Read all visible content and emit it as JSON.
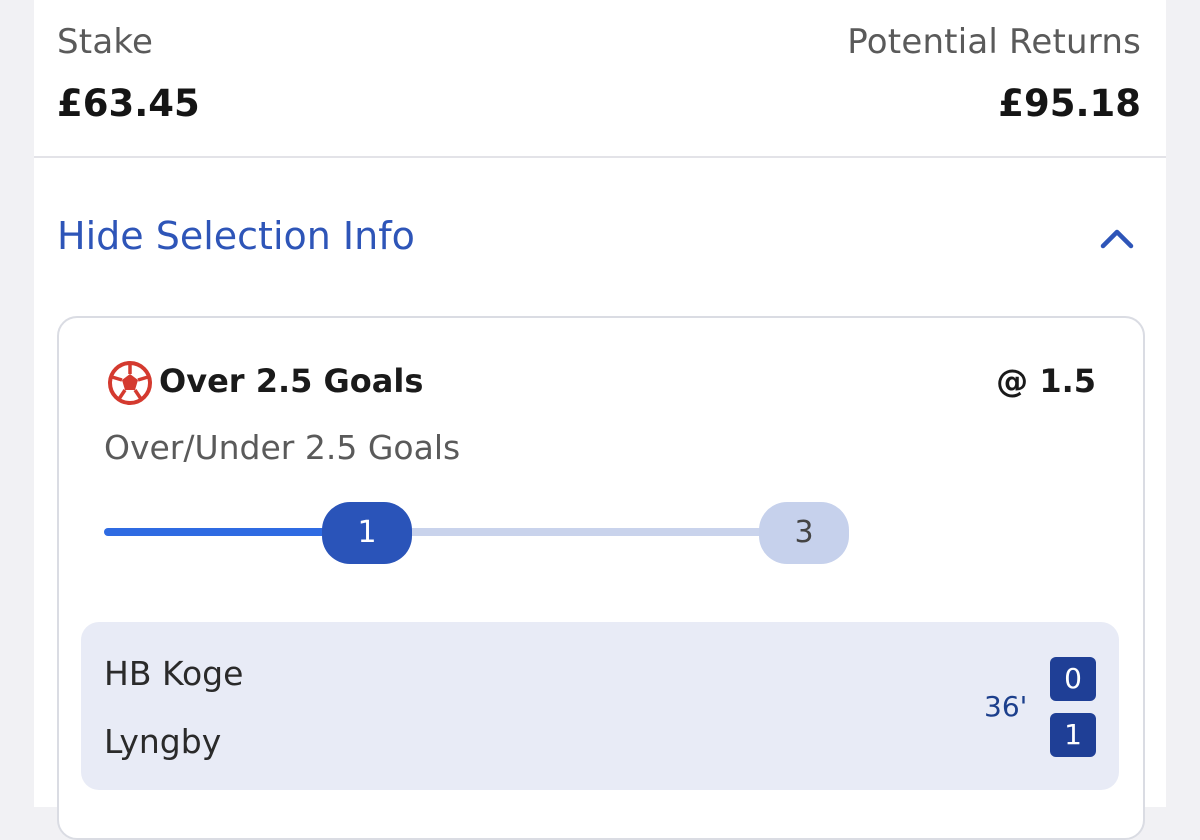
{
  "summary": {
    "stake_label": "Stake",
    "stake_value": "£63.45",
    "returns_label": "Potential Returns",
    "returns_value": "£95.18"
  },
  "toggle": {
    "label": "Hide Selection Info",
    "icon": "chevron-up-icon"
  },
  "selection": {
    "icon": "football-icon",
    "title": "Over 2.5 Goals",
    "odds": "@ 1.5",
    "market": "Over/Under 2.5 Goals",
    "progress": {
      "current": "1",
      "target": "3"
    }
  },
  "match": {
    "home_team": "HB Koge",
    "away_team": "Lyngby",
    "minute": "36'",
    "home_score": "0",
    "away_score": "1"
  },
  "colors": {
    "accent": "#2e55b8",
    "progress_fill": "#2f6be2",
    "progress_empty": "#c9d3ec",
    "score_box": "#1f3f96",
    "ball_red": "#d43a2f"
  }
}
